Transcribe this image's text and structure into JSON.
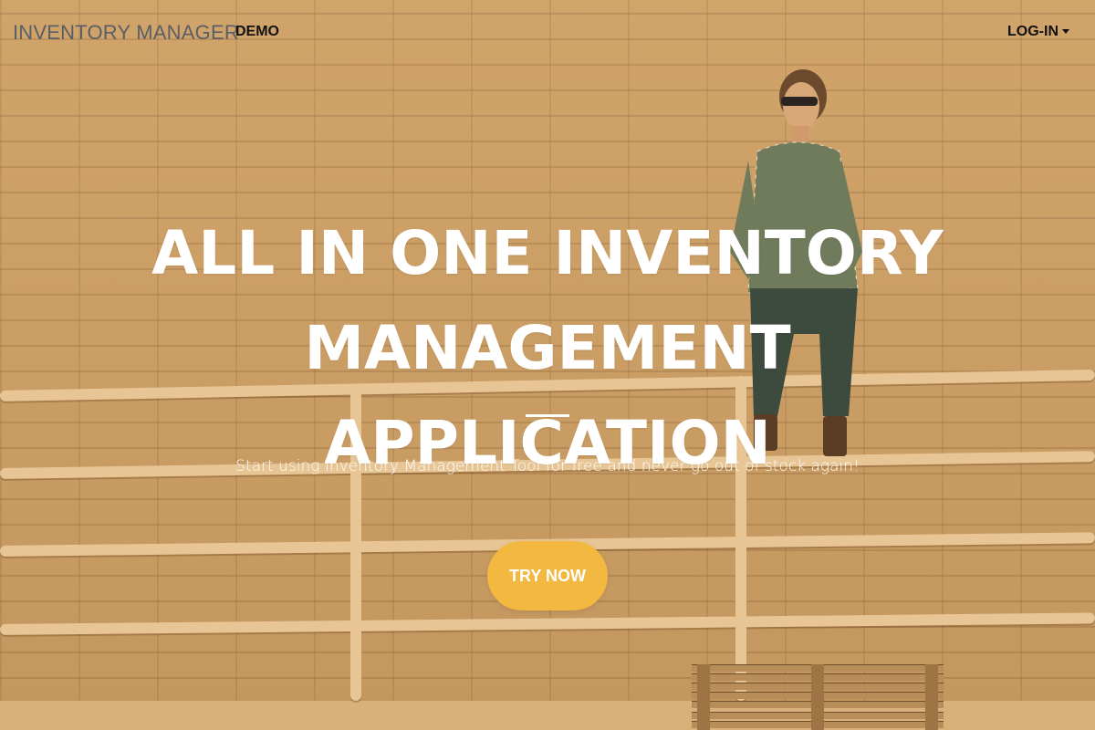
{
  "navbar": {
    "brand": "INVENTORY MANAGER",
    "links": [
      {
        "label": "DEMO"
      }
    ],
    "login": {
      "label": "LOG-IN",
      "icon": "caret-down-icon"
    }
  },
  "hero": {
    "title_lines": [
      "ALL IN ONE INVENTORY",
      "MANAGEMENT APPLICATION"
    ],
    "subtitle": "Start using Inventory Management Tool for free and never go out of stock again!",
    "cta_label": "TRY NOW"
  },
  "colors": {
    "background": "#cfa064",
    "cta": "#f2b83f",
    "text_light": "#ffffff",
    "brand_text": "#5a5f66"
  }
}
